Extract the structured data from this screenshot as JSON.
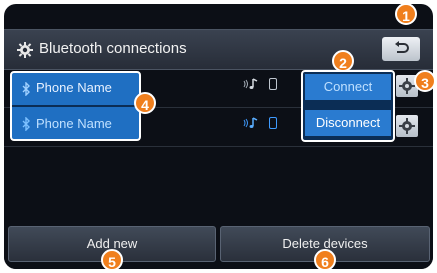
{
  "header": {
    "title": "Bluetooth connections"
  },
  "devices": [
    {
      "name": "Phone Name",
      "button_label": "Connect"
    },
    {
      "name": "Phone Name",
      "button_label": "Disconnect"
    }
  ],
  "footer": {
    "add_label": "Add new",
    "delete_label": "Delete devices"
  },
  "callouts": [
    "1",
    "2",
    "3",
    "4",
    "5",
    "6"
  ],
  "colors": {
    "selection_blue": "#1f6fc2",
    "accent_orange": "#f07f1d",
    "background": "#0c0f16"
  },
  "icons": [
    "settings-gear-icon",
    "back-arrow-icon",
    "bluetooth-icon",
    "audio-streaming-icon",
    "phone-icon"
  ]
}
